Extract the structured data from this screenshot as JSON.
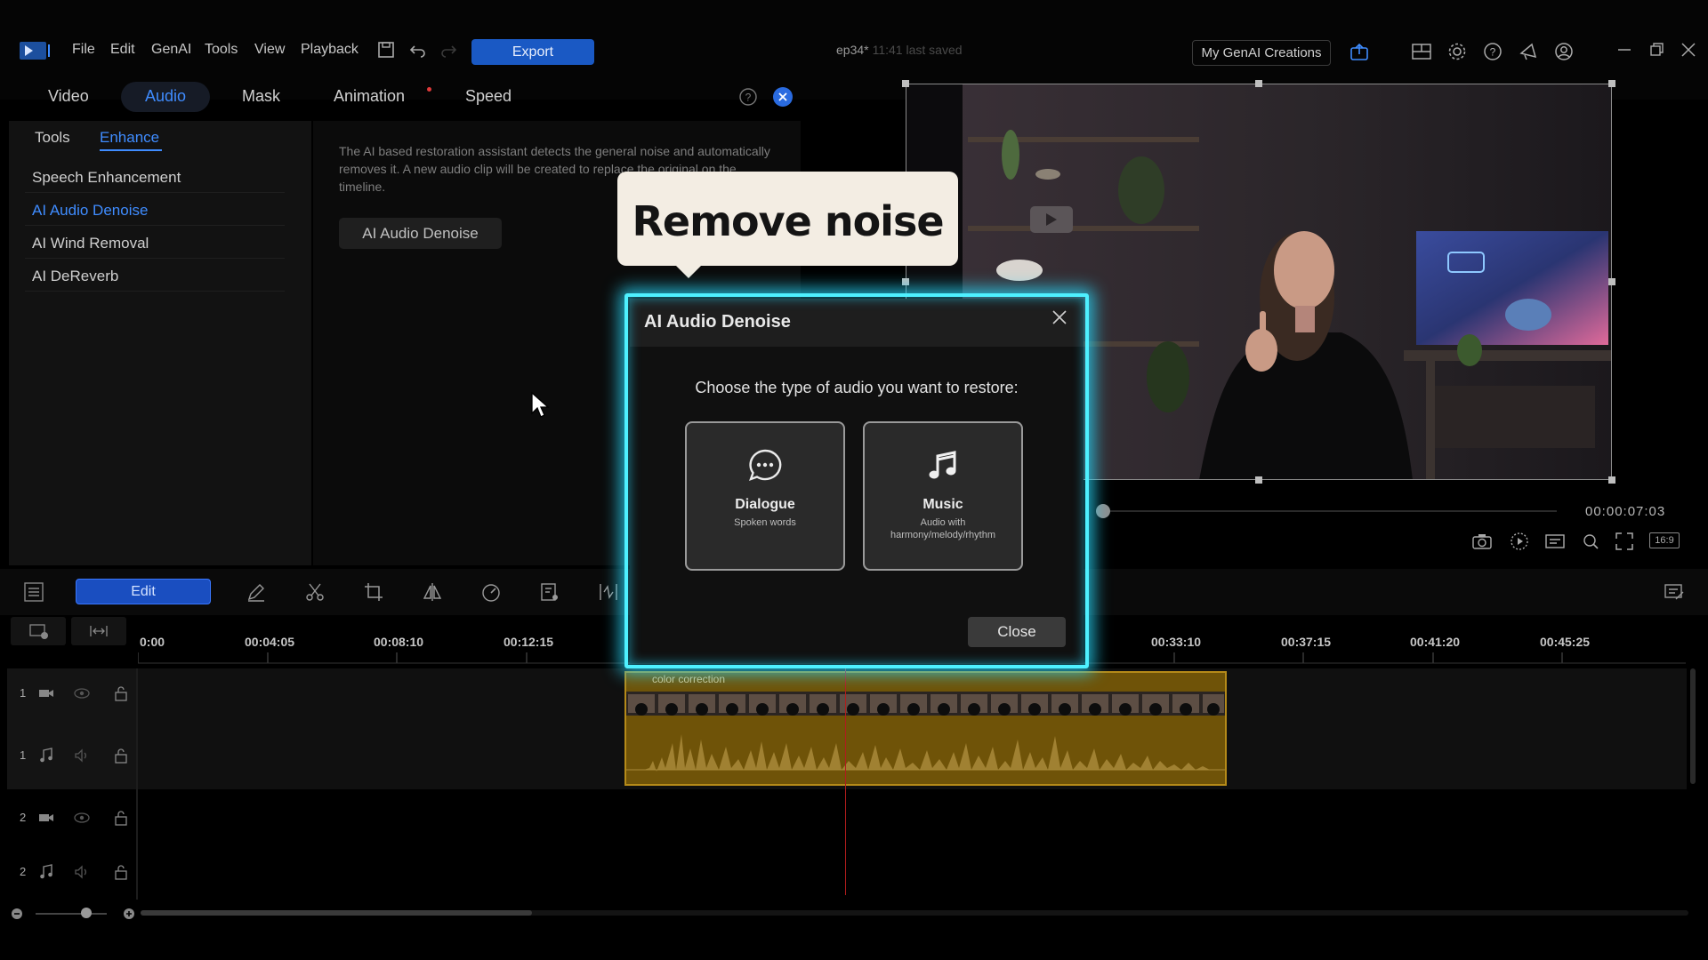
{
  "menu": {
    "items": [
      "File",
      "Edit",
      "GenAI",
      "Tools",
      "View",
      "Playback"
    ],
    "export_label": "Export",
    "project_name": "ep34*",
    "saved_status": "11:41 last saved",
    "genai_button": "My GenAI Creations"
  },
  "panel": {
    "tabs": [
      "Video",
      "Audio",
      "Mask",
      "Animation",
      "Speed"
    ],
    "active_tab": "Audio",
    "sub_tabs": [
      "Tools",
      "Enhance"
    ],
    "active_sub_tab": "Enhance",
    "features": [
      "Speech Enhancement",
      "AI Audio Denoise",
      "AI Wind Removal",
      "AI DeReverb"
    ],
    "active_feature": "AI Audio Denoise",
    "description": "The AI based restoration assistant detects the general noise and automatically removes it. A new audio clip will be created to replace the original on the timeline.",
    "action_button": "AI Audio Denoise"
  },
  "callout": {
    "text": "Remove noise"
  },
  "dialog": {
    "title": "AI Audio Denoise",
    "prompt": "Choose the type of audio you want to restore:",
    "options": [
      {
        "title": "Dialogue",
        "subtitle": "Spoken words",
        "icon": "speech-bubble-icon"
      },
      {
        "title": "Music",
        "subtitle": "Audio with harmony/melody/rhythm",
        "icon": "music-note-icon"
      }
    ],
    "close_label": "Close"
  },
  "preview": {
    "timecode": "00:00:07:03",
    "aspect": "16:9"
  },
  "timeline": {
    "edit_label": "Edit",
    "ruler_labels": [
      "0:00",
      "00:04:05",
      "00:08:10",
      "00:12:15",
      "00:33:10",
      "00:37:15",
      "00:41:20",
      "00:45:25"
    ],
    "tracks": [
      {
        "num": "1",
        "kind": "video"
      },
      {
        "num": "1",
        "kind": "audio"
      },
      {
        "num": "2",
        "kind": "video"
      },
      {
        "num": "2",
        "kind": "audio"
      }
    ],
    "clip_name": "color correction"
  },
  "colors": {
    "accent": "#3f8cff",
    "export": "#1a59c4",
    "glow": "#4ef0ff",
    "clip": "#6f5308"
  }
}
